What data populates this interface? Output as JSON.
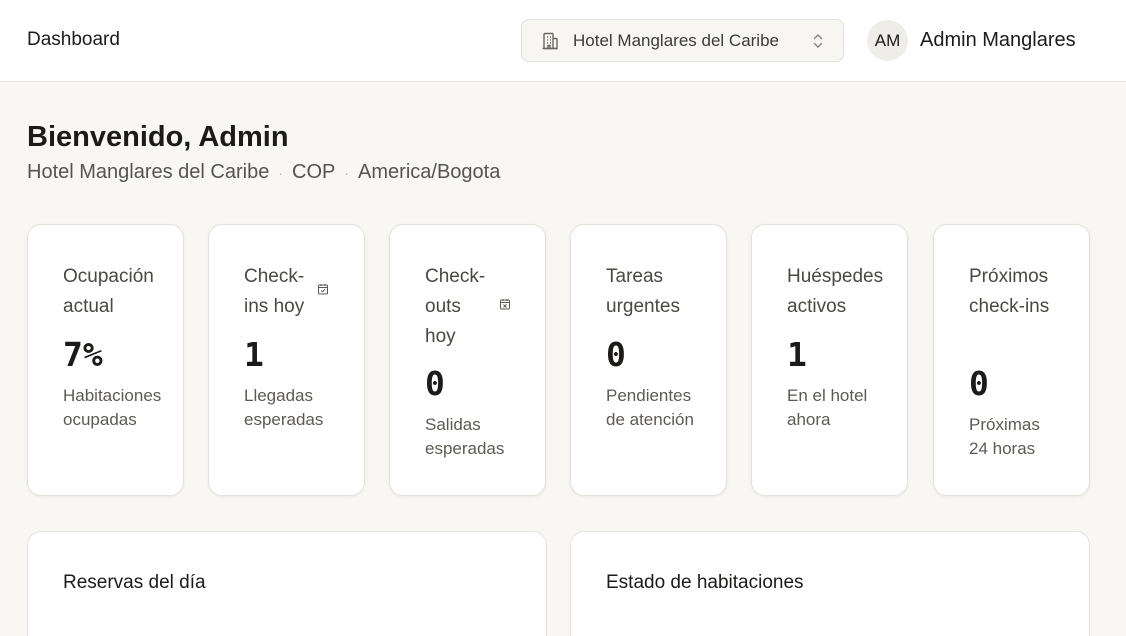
{
  "header": {
    "title": "Dashboard",
    "hotel_selector": {
      "value": "Hotel Manglares del Caribe",
      "icon": "building-icon",
      "chevron_icon": "chevrons-up-down-icon"
    },
    "user": {
      "initials": "AM",
      "name": "Admin Manglares"
    }
  },
  "welcome": {
    "heading": "Bienvenido, Admin",
    "hotel": "Hotel Manglares del Caribe",
    "currency": "COP",
    "timezone": "America/Bogota",
    "separator": "·"
  },
  "cards": [
    {
      "title": "Ocupación actual",
      "value": "7%",
      "subtitle": "Habitaciones ocupadas",
      "icon": null
    },
    {
      "title": "Check-ins hoy",
      "value": "1",
      "subtitle": "Llegadas esperadas",
      "icon": "calendar-check-icon"
    },
    {
      "title": "Check-outs hoy",
      "value": "0",
      "subtitle": "Salidas esperadas",
      "icon": "calendar-x-icon"
    },
    {
      "title": "Tareas urgentes",
      "value": "0",
      "subtitle": "Pendientes de atención",
      "icon": null
    },
    {
      "title": "Huéspedes activos",
      "value": "1",
      "subtitle": "En el hotel ahora",
      "icon": null
    },
    {
      "title": "Próximos check-ins",
      "value": "0",
      "subtitle": "Próximas 24 horas",
      "icon": null
    }
  ],
  "panels": [
    {
      "title": "Reservas del día"
    },
    {
      "title": "Estado de habitaciones"
    }
  ],
  "colors": {
    "background": "#f8f7f4",
    "surface": "#ffffff",
    "border": "#e4e2dc",
    "text": "#1c1b19",
    "muted": "#5d5a55"
  }
}
